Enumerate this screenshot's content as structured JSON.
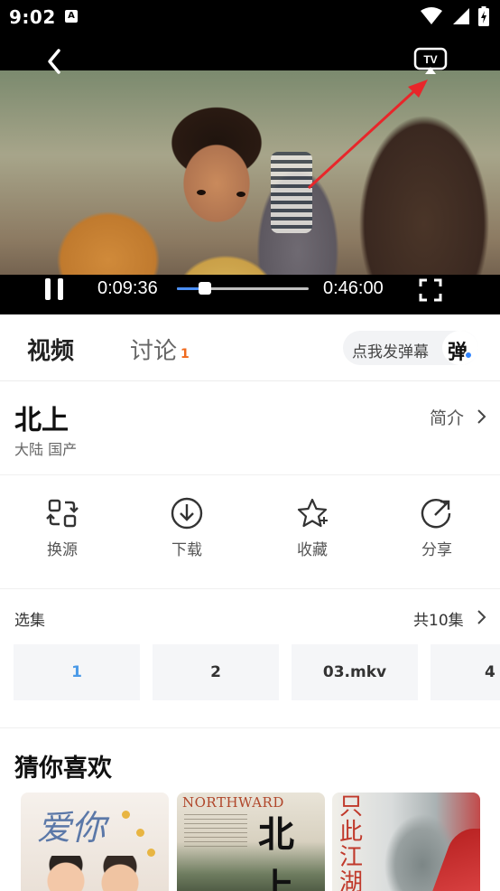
{
  "status_bar": {
    "time": "9:02",
    "notification_letter": "A",
    "icons": [
      "wifi-icon",
      "signal-icon",
      "battery-charging-icon"
    ]
  },
  "player": {
    "current_time": "0:09:36",
    "total_time": "0:46:00",
    "progress": 0.21,
    "cast_label": "TV",
    "state": "playing",
    "accent_color": "#4b8ff5"
  },
  "tabs": {
    "video": "视频",
    "discuss": "讨论",
    "discuss_count": "1",
    "danmu_prompt": "点我发弹幕",
    "danmu_icon_char": "弹"
  },
  "show": {
    "title": "北上",
    "meta": "大陆 国产",
    "intro_link": "简介"
  },
  "actions": [
    {
      "label": "换源",
      "icon": "swap-source-icon"
    },
    {
      "label": "下载",
      "icon": "download-icon"
    },
    {
      "label": "收藏",
      "icon": "star-icon"
    },
    {
      "label": "分享",
      "icon": "share-icon"
    }
  ],
  "episodes": {
    "heading": "选集",
    "total": "共10集",
    "items": [
      "1",
      "2",
      "03.mkv",
      "4"
    ],
    "active_index": 0,
    "active_color": "#4b9ae8"
  },
  "recommendations": {
    "heading": "猜你喜欢",
    "posters": [
      {
        "text": "爱你"
      },
      {
        "text_en": "NORTHWARD",
        "text_cn": "北上"
      },
      {
        "text": "只此江湖梦"
      }
    ]
  },
  "annotation": {
    "color": "#e8262a"
  }
}
